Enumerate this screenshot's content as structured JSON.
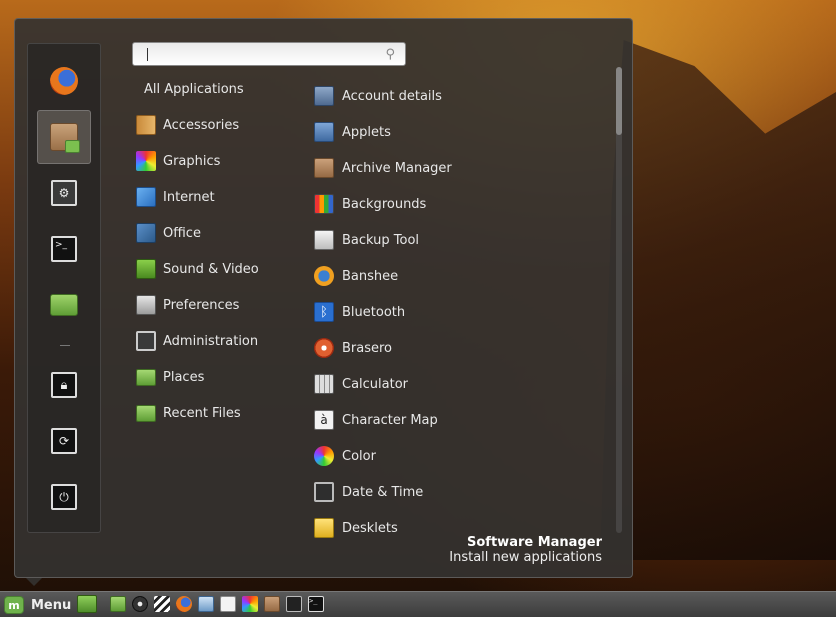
{
  "search": {
    "value": "",
    "placeholder": ""
  },
  "categories_header": "All Applications",
  "categories": [
    {
      "label": "Accessories",
      "icon": "accessories-icon"
    },
    {
      "label": "Graphics",
      "icon": "graphics-icon"
    },
    {
      "label": "Internet",
      "icon": "internet-icon"
    },
    {
      "label": "Office",
      "icon": "office-icon"
    },
    {
      "label": "Sound & Video",
      "icon": "sound-video-icon"
    },
    {
      "label": "Preferences",
      "icon": "preferences-icon"
    },
    {
      "label": "Administration",
      "icon": "administration-icon"
    },
    {
      "label": "Places",
      "icon": "places-folder-icon"
    },
    {
      "label": "Recent Files",
      "icon": "recent-files-icon"
    }
  ],
  "applications": [
    {
      "label": "Account details",
      "icon": "account-details-icon"
    },
    {
      "label": "Applets",
      "icon": "applets-icon"
    },
    {
      "label": "Archive Manager",
      "icon": "archive-manager-icon"
    },
    {
      "label": "Backgrounds",
      "icon": "backgrounds-icon"
    },
    {
      "label": "Backup Tool",
      "icon": "backup-tool-icon"
    },
    {
      "label": "Banshee",
      "icon": "banshee-icon"
    },
    {
      "label": "Bluetooth",
      "icon": "bluetooth-icon"
    },
    {
      "label": "Brasero",
      "icon": "brasero-icon"
    },
    {
      "label": "Calculator",
      "icon": "calculator-icon"
    },
    {
      "label": "Character Map",
      "icon": "character-map-icon"
    },
    {
      "label": "Color",
      "icon": "color-icon"
    },
    {
      "label": "Date & Time",
      "icon": "date-time-icon"
    },
    {
      "label": "Desklets",
      "icon": "desklets-icon"
    }
  ],
  "favorites": [
    {
      "name": "firefox",
      "icon": "firefox-icon"
    },
    {
      "name": "software-manager",
      "icon": "software-manager-icon",
      "active": true
    },
    {
      "name": "system-settings",
      "icon": "system-settings-icon"
    },
    {
      "name": "terminal",
      "icon": "terminal-icon"
    },
    {
      "name": "files",
      "icon": "folder-icon"
    },
    {
      "name": "lock-screen",
      "icon": "lock-icon"
    },
    {
      "name": "logout",
      "icon": "logout-icon"
    },
    {
      "name": "shutdown",
      "icon": "power-icon"
    }
  ],
  "info": {
    "title": "Software Manager",
    "description": "Install new applications"
  },
  "panel": {
    "menu_label": "Menu",
    "launchers": [
      "show-desktop-icon",
      "files-icon",
      "banshee-icon",
      "clapper-icon",
      "firefox-icon",
      "pidgin-icon",
      "document-icon",
      "image-viewer-icon",
      "archive-icon",
      "system-monitor-icon",
      "terminal-icon"
    ]
  },
  "colors": {
    "panel_bg": "#343230",
    "accent_green": "#6fb24c"
  }
}
